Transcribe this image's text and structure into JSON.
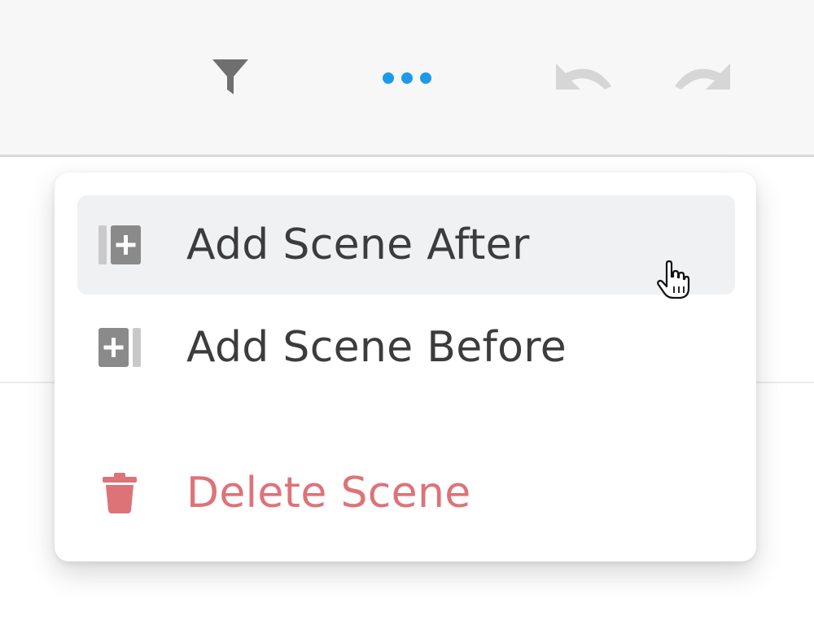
{
  "toolbar": {
    "icons": {
      "filter": "filter-icon",
      "more": "more-horizontal-icon",
      "undo": "undo-icon",
      "redo": "redo-icon"
    },
    "colors": {
      "filter": "#6f6f6f",
      "more_active": "#1d9be8",
      "undo_redo_disabled": "#d6d6d6"
    }
  },
  "menu": {
    "items": [
      {
        "label": "Add Scene After",
        "icon": "add-scene-after-icon",
        "state": "hover"
      },
      {
        "label": "Add Scene Before",
        "icon": "add-scene-before-icon"
      },
      {
        "label": "Delete Scene",
        "icon": "trash-icon",
        "variant": "danger"
      }
    ],
    "colors": {
      "text": "#3c3c3c",
      "icon": "#8a8a8a",
      "danger": "#dd7378",
      "hover_bg": "#f0f1f3"
    }
  }
}
